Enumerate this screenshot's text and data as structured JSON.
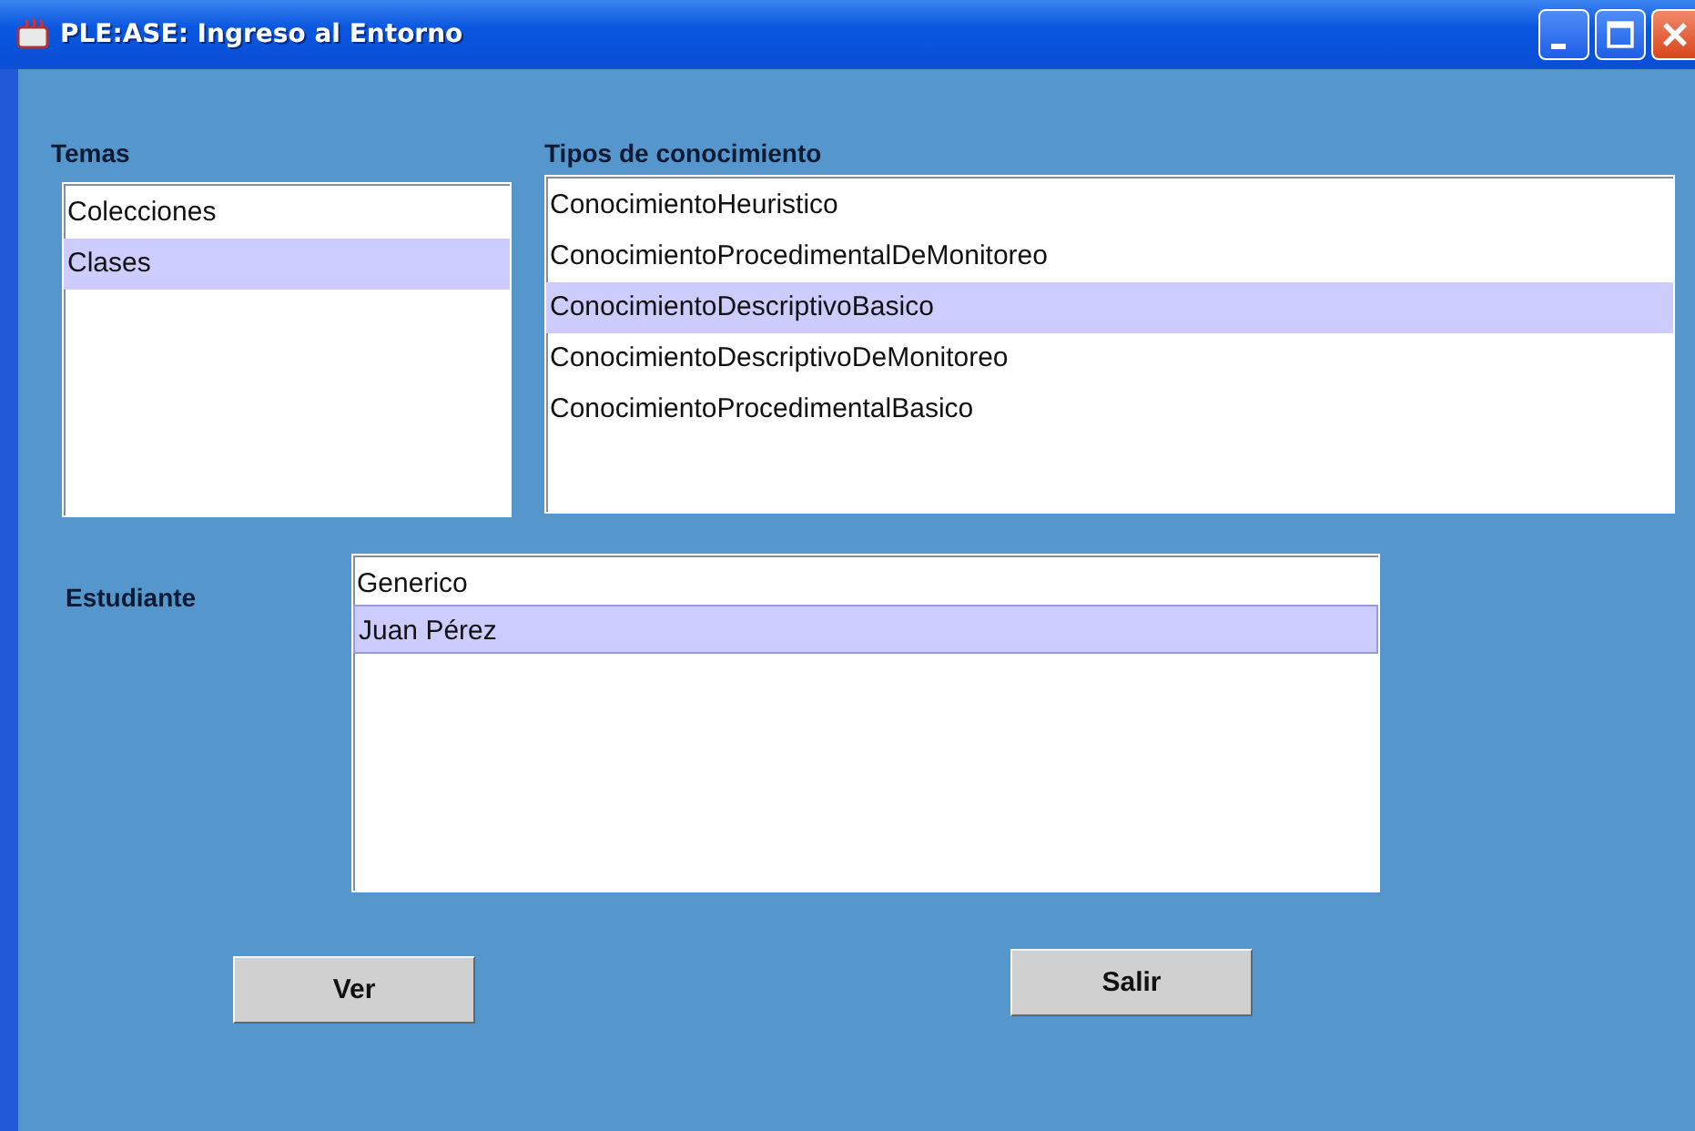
{
  "window": {
    "title": "PLE:ASE: Ingreso al Entorno"
  },
  "temas": {
    "label": "Temas",
    "items": [
      {
        "label": "Colecciones",
        "selected": false
      },
      {
        "label": "Clases",
        "selected": true
      }
    ]
  },
  "tipos": {
    "label": "Tipos de conocimiento",
    "items": [
      {
        "label": "ConocimientoHeuristico",
        "selected": false
      },
      {
        "label": "ConocimientoProcedimentalDeMonitoreo",
        "selected": false
      },
      {
        "label": "ConocimientoDescriptivoBasico",
        "selected": true
      },
      {
        "label": "ConocimientoDescriptivoDeMonitoreo",
        "selected": false
      },
      {
        "label": "ConocimientoProcedimentalBasico",
        "selected": false
      }
    ]
  },
  "estudiante": {
    "label": "Estudiante",
    "items": [
      {
        "label": "Generico",
        "selected": false
      },
      {
        "label": "Juan Pérez",
        "selected": true
      }
    ]
  },
  "buttons": [
    "Ver",
    "Salir"
  ]
}
